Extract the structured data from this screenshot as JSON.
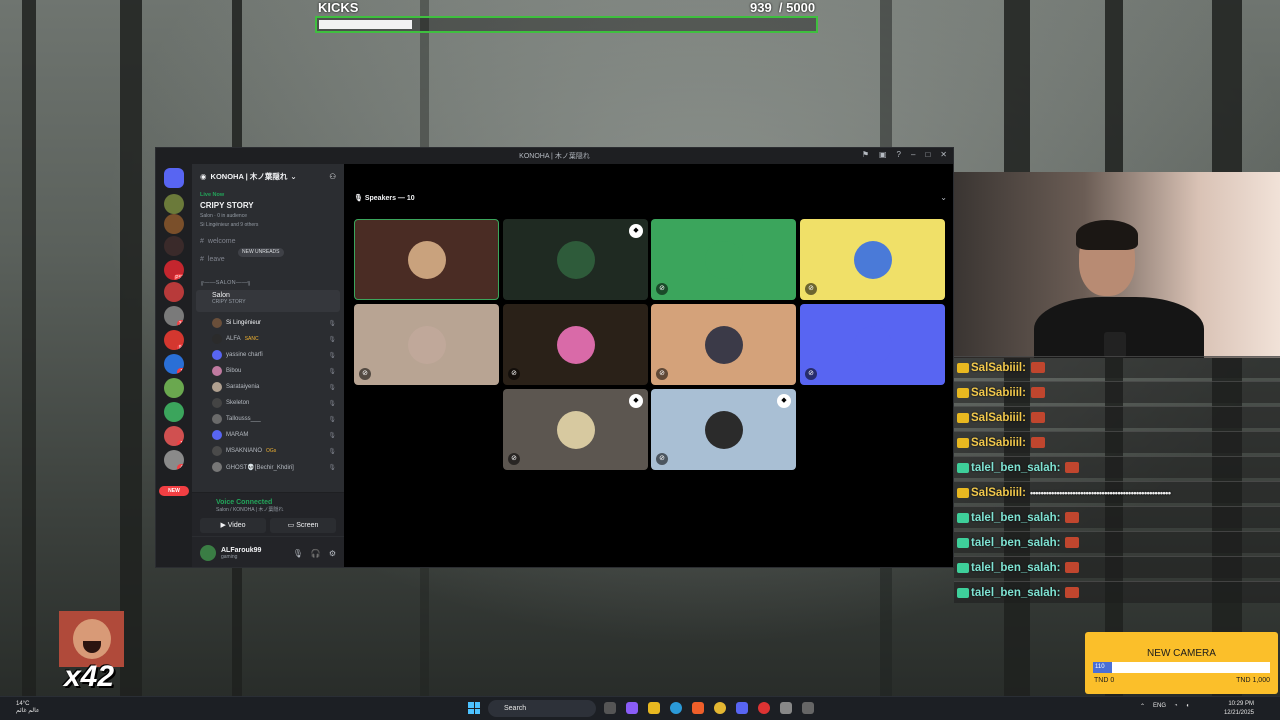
{
  "kicks": {
    "title": "KICKS",
    "count": "939  / 5000",
    "progress": 0.1878
  },
  "discord": {
    "window_title": "KONOHA | 木ノ葉隠れ",
    "server_name": "KONOHA | 木ノ葉隠れ",
    "stage": {
      "live": "Live Now",
      "title": "CRIPY STORY",
      "meta": "Salon · 0 in audience",
      "speakers": "Si Lingénieur and 9 others"
    },
    "channels": {
      "welcome": "welcome",
      "leave": "leave",
      "new_unreads": "NEW UNREADS",
      "category": "╔——SALON——╗"
    },
    "voice_channel": {
      "name": "Salon",
      "subtitle": "CRIPY STORY"
    },
    "members": [
      {
        "name": "Si Lingénieur"
      },
      {
        "name": "ALFA",
        "tag": "SANC"
      },
      {
        "name": "yassine charfi"
      },
      {
        "name": "Bibou"
      },
      {
        "name": "Sarataiyenia"
      },
      {
        "name": "Skeleton"
      },
      {
        "name": "Tallousss___"
      },
      {
        "name": "MARAM"
      },
      {
        "name": "MSAKNIANO",
        "tag": "OGs"
      },
      {
        "name": "GHOST💀[Bechir_Khdiri]"
      }
    ],
    "server_badges": [
      "",
      "",
      "",
      "PST",
      "",
      "31",
      "94",
      "1",
      "",
      "",
      "1",
      "4",
      "NEW"
    ],
    "voice_panel": {
      "status": "Voice Connected",
      "sub": "Salon / KONOHA | 木ノ葉隠れ",
      "video": "Video",
      "screen": "Screen"
    },
    "user": {
      "name": "ALFarouk99",
      "status": "gaming"
    },
    "speakers_header": "Speakers — 10",
    "tiles": [
      {
        "bg": "#4a2c24",
        "avatar": "#c9a27d",
        "muted": false,
        "shield": false
      },
      {
        "bg": "#1f2a22",
        "avatar": "#2e5b3a",
        "muted": false,
        "shield": true
      },
      {
        "bg": "#3ba55c",
        "avatar": "#3ba55c",
        "muted": true,
        "shield": false
      },
      {
        "bg": "#f0e068",
        "avatar": "#4a7ad8",
        "muted": true,
        "shield": false
      },
      {
        "bg": "#b8a493",
        "avatar": "#c0a89a",
        "muted": true,
        "shield": false
      },
      {
        "bg": "#2a2118",
        "avatar": "#d96aa8",
        "muted": true,
        "shield": false
      },
      {
        "bg": "#d4a27a",
        "avatar": "#3b3a48",
        "muted": true,
        "shield": false
      },
      {
        "bg": "#5865f2",
        "avatar": "#5865f2",
        "muted": true,
        "shield": false
      },
      {
        "bg": "#5c5650",
        "avatar": "#d7c9a0",
        "muted": true,
        "shield": true
      },
      {
        "bg": "#a9bfd4",
        "avatar": "#2b2b2b",
        "muted": true,
        "shield": true
      }
    ]
  },
  "chat": [
    {
      "user": "SalSabiiil:",
      "color": "#f2c94c",
      "badge": "#e8b820",
      "msg": ""
    },
    {
      "user": "SalSabiiil:",
      "color": "#f2c94c",
      "badge": "#e8b820",
      "msg": ""
    },
    {
      "user": "SalSabiiil:",
      "color": "#f2c94c",
      "badge": "#e8b820",
      "msg": ""
    },
    {
      "user": "SalSabiiil:",
      "color": "#f2c94c",
      "badge": "#e8b820",
      "msg": ""
    },
    {
      "user": "talel_ben_salah:",
      "color": "#7fe3d3",
      "badge": "#3ecf9a",
      "msg": ""
    },
    {
      "user": "SalSabiiil:",
      "color": "#f2c94c",
      "badge": "#e8b820",
      "msg": "•••••••••••••••••••••••••••••••••••••••••••••••••••••"
    },
    {
      "user": "talel_ben_salah:",
      "color": "#7fe3d3",
      "badge": "#3ecf9a",
      "msg": ""
    },
    {
      "user": "talel_ben_salah:",
      "color": "#7fe3d3",
      "badge": "#3ecf9a",
      "msg": ""
    },
    {
      "user": "talel_ben_salah:",
      "color": "#7fe3d3",
      "badge": "#3ecf9a",
      "msg": ""
    },
    {
      "user": "talel_ben_salah:",
      "color": "#7fe3d3",
      "badge": "#3ecf9a",
      "msg": ""
    }
  ],
  "emote": {
    "count": "x42"
  },
  "goal": {
    "title": "NEW CAMERA",
    "fill_label": "110",
    "progress": 0.11,
    "min": "TND 0",
    "max": "TND 1,000"
  },
  "taskbar": {
    "weather_temp": "14°C",
    "weather_desc": "عالم غائم",
    "search": "Search",
    "lang": "ENG",
    "time": "10:29 PM",
    "date": "12/21/2025"
  }
}
